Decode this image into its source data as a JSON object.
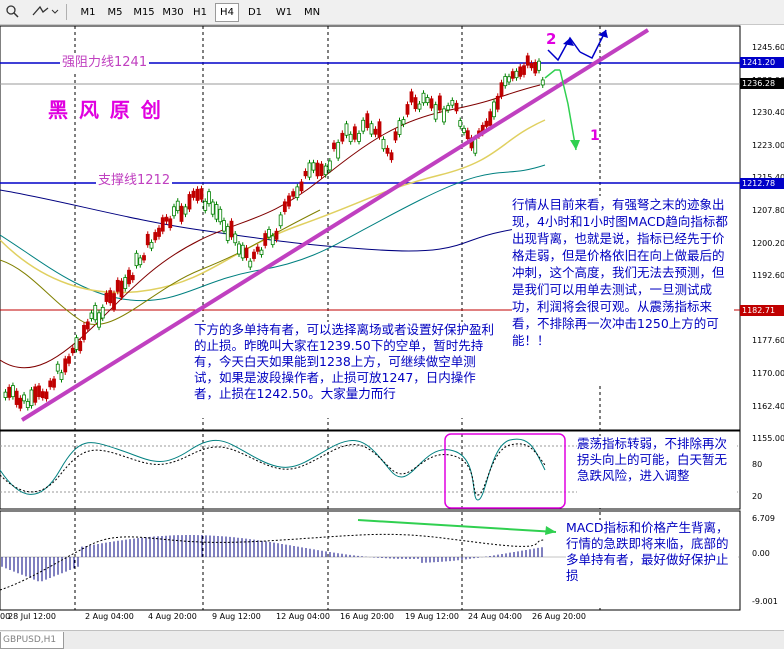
{
  "toolbar": {
    "timeframes": [
      "M1",
      "M5",
      "M15",
      "M30",
      "H1",
      "H4",
      "D1",
      "W1",
      "MN"
    ],
    "active_timeframe": "H4"
  },
  "symbol_tab": "GBPUSD,H1",
  "price_scale": {
    "ticks": [
      "1245.60",
      "1238.00",
      "1230.40",
      "1223.00",
      "1215.40",
      "1207.80",
      "1200.20",
      "1192.60",
      "1185.20",
      "1177.60",
      "1170.00",
      "1162.40",
      "1155.00"
    ],
    "tags": [
      {
        "label": "1241.20",
        "color": "#0000c8"
      },
      {
        "label": "1236.28",
        "color": "#000000"
      },
      {
        "label": "1212.78",
        "color": "#0000c8"
      },
      {
        "label": "1182.71",
        "color": "#c00000"
      }
    ],
    "osc_ticks": [
      "80",
      "20"
    ],
    "macd_ticks": [
      "6.709",
      "0.00",
      "-9.001"
    ]
  },
  "x_axis": [
    "28 Jul 12:00",
    "2 Aug 04:00",
    "4 Aug 20:00",
    "9 Aug 12:00",
    "12 Aug 04:00",
    "16 Aug 20:00",
    "19 Aug 12:00",
    "24 Aug 04:00",
    "26 Aug 20:00"
  ],
  "x_axis_partial": "00",
  "annotations": {
    "resistance": "强阻力线1241",
    "support": "支撑线1212",
    "brand": "黑 风 原 创",
    "wave2": "2",
    "wave1": "1",
    "main_comment": "行情从目前来看，有强弩之末的迹象出现，4小时和1小时图MACD趋向指标都出现背离，也就是说，指标已经先于价格走弱，但是价格依旧在向上做最后的冲刺，这个高度，我们无法去预测，但是我们可以用单去测试，一旦测试成功，利润将会很可观。从震荡指标来看，不排除再一次冲击1250上方的可能！！",
    "strategy_comment": "下方的多单持有者，可以选择离场或者设置好保护盈利的止损。昨晚叫大家在1239.50下的空单，暂时先持有，今天白天如果能到1238上方，可继续做空单测试，如果是波段操作者，止损可放1247，日内操作者，止损在1242.50。大家量力而行",
    "osc_comment": "震荡指标转弱，不排除再次拐头向上的可能，白天暂无急跌风险，进入调整",
    "macd_comment": "MACD指标和价格产生背离，行情的急跌即将来临，底部的多单持有者，最好做好保护止损"
  },
  "colors": {
    "up_candle": "#008000",
    "down_candle": "#c00000",
    "trendline": "#c040c0",
    "level": "#0000c8",
    "annotation": "#e000e0",
    "arrow": "#30d050"
  }
}
